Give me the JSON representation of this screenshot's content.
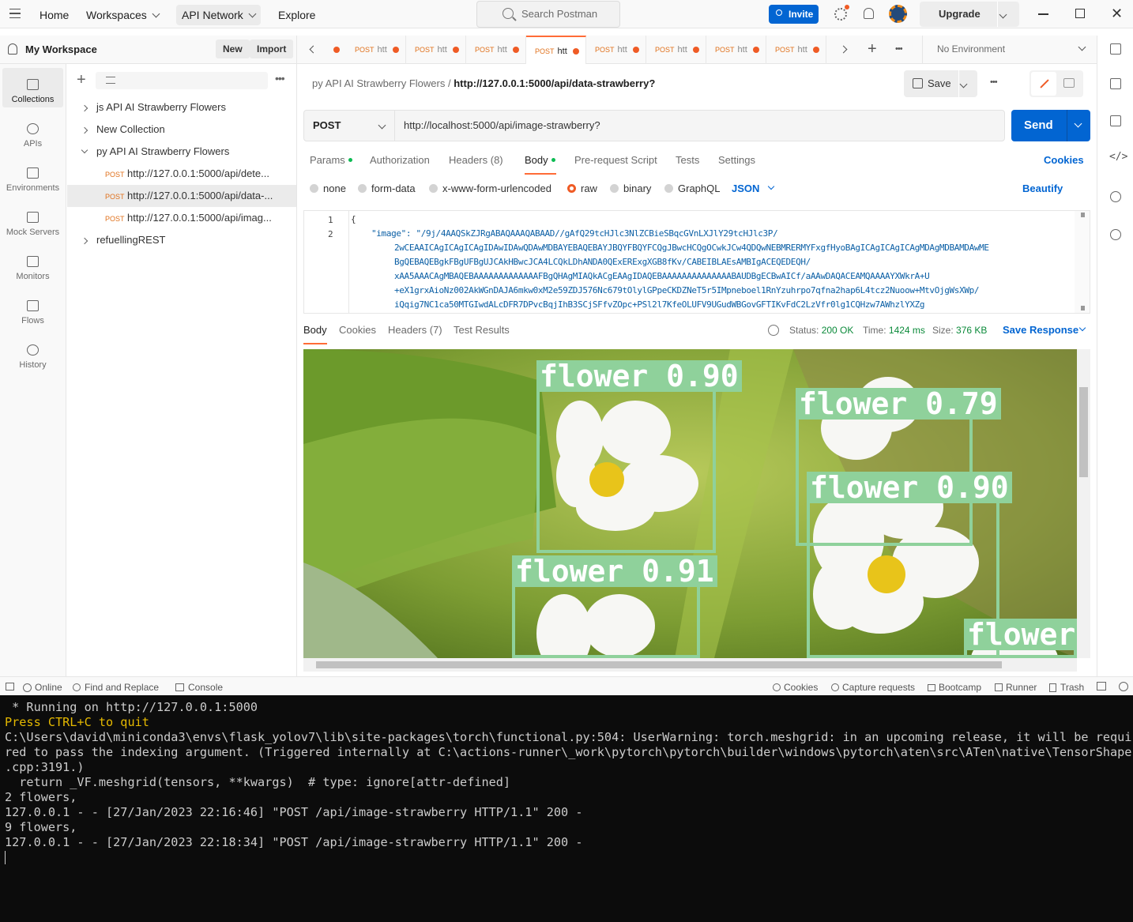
{
  "topbar": {
    "home": "Home",
    "workspaces": "Workspaces",
    "api_network": "API Network",
    "explore": "Explore",
    "search_placeholder": "Search Postman",
    "invite": "Invite",
    "upgrade": "Upgrade"
  },
  "workspace": {
    "name": "My Workspace",
    "new_label": "New",
    "import_label": "Import"
  },
  "rail": [
    {
      "label": "Collections",
      "icon": "collections-icon"
    },
    {
      "label": "APIs",
      "icon": "apis-icon"
    },
    {
      "label": "Environments",
      "icon": "environments-icon"
    },
    {
      "label": "Mock Servers",
      "icon": "mock-servers-icon"
    },
    {
      "label": "Monitors",
      "icon": "monitors-icon"
    },
    {
      "label": "Flows",
      "icon": "flows-icon"
    },
    {
      "label": "History",
      "icon": "history-icon"
    }
  ],
  "collections": [
    {
      "label": "js API AI Strawberry Flowers"
    },
    {
      "label": "New Collection"
    },
    {
      "label": "py API AI Strawberry Flowers"
    },
    {
      "method": "POST",
      "label": "http://127.0.0.1:5000/api/dete..."
    },
    {
      "method": "POST",
      "label": "http://127.0.0.1:5000/api/data-..."
    },
    {
      "method": "POST",
      "label": "http://127.0.0.1:5000/api/imag..."
    },
    {
      "label": "refuellingREST"
    }
  ],
  "tabs": [
    {
      "method": "POST",
      "label": "htt"
    },
    {
      "method": "POST",
      "label": "htt"
    },
    {
      "method": "POST",
      "label": "htt"
    },
    {
      "method": "POST",
      "label": "htt"
    },
    {
      "method": "POST",
      "label": "htt"
    },
    {
      "method": "POST",
      "label": "htt"
    },
    {
      "method": "POST",
      "label": "htt"
    },
    {
      "method": "POST",
      "label": "htt"
    }
  ],
  "environment": "No Environment",
  "request": {
    "breadcrumb_parent": "py API AI Strawberry Flowers",
    "breadcrumb_sep": "/",
    "breadcrumb_title": "http://127.0.0.1:5000/api/data-strawberry?",
    "save_label": "Save",
    "method": "POST",
    "url": "http://localhost:5000/api/image-strawberry?",
    "send_label": "Send",
    "tabs": [
      "Params",
      "Authorization",
      "Headers (8)",
      "Body",
      "Pre-request Script",
      "Tests",
      "Settings"
    ],
    "cookies_label": "Cookies",
    "body_types": [
      "none",
      "form-data",
      "x-www-form-urlencoded",
      "raw",
      "binary",
      "GraphQL"
    ],
    "body_format": "JSON",
    "beautify_label": "Beautify",
    "code_lines": [
      "{",
      "\"image\": \"/9j/4AAQSkZJRgABAQAAAQABAAD//gAfQ29tcHJlc3NlZCBieSBqcGVnLXJlY29tcHJlc3P/",
      "2wCEAAICAgICAgICAgIDAwIDAwQDAwMDBAYEBAQEBAYJBQYFBQYFCQgJBwcHCQgOCwkJCw4QDQwNEBMRERMYFxgfHyoBAgICAgICAgICAgMDAgMDBAMDAwME",
      "BgQEBAQEBgkFBgUFBgUJCAkHBwcJCA4LCQkLDhANDA0QExERExgXGB8fKv/CABEIBLAEsAMBIgACEQEDEQH/",
      "xAA5AAACAgMBAQEBAAAAAAAAAAAAAFBgQHAgMIAQkACgEAAgIDAQEBAAAAAAAAAAAAAABAUDBgECBwAICf/aAAwDAQACEAMQAAAAYXWkrA+U",
      "+eX1grxAioNz002AkWGnDAJA6mkw0xM2e59ZDJ576Nc679tOlylGPpeCKDZNeT5r5IMpneboel1RnYzuhrpo7qfna2hap6L4tcz2Nuoow+MtvOjgWsXWp/",
      "iQqig7NC1ca50MTGIwdALcDFR7DPvcBqjIhB3SCjSFfvZOpc+PSl2l7KfeOLUFV9UGudWBGovGFTIKvFdC2LzVfr0lg1CQHzw7AWhzlYXZg"
    ]
  },
  "response": {
    "tabs": [
      "Body",
      "Cookies",
      "Headers (7)",
      "Test Results"
    ],
    "status_label": "Status:",
    "status_value": "200 OK",
    "time_label": "Time:",
    "time_value": "1424 ms",
    "size_label": "Size:",
    "size_value": "376 KB",
    "save_response": "Save Response",
    "detections": [
      {
        "label": "flower 0.90"
      },
      {
        "label": "flower 0.79"
      },
      {
        "label": "flower 0.90"
      },
      {
        "label": "flower 0.91"
      },
      {
        "label": "flower"
      }
    ]
  },
  "footer": {
    "online": "Online",
    "find_replace": "Find and Replace",
    "console": "Console",
    "cookies": "Cookies",
    "capture": "Capture requests",
    "bootcamp": "Bootcamp",
    "runner": "Runner",
    "trash": "Trash"
  },
  "terminal": [
    " * Running on http://127.0.0.1:5000",
    "Press CTRL+C to quit",
    "C:\\Users\\david\\miniconda3\\envs\\flask_yolov7\\lib\\site-packages\\torch\\functional.py:504: UserWarning: torch.meshgrid: in an upcoming release, it will be requi",
    "red to pass the indexing argument. (Triggered internally at C:\\actions-runner\\_work\\pytorch\\pytorch\\builder\\windows\\pytorch\\aten\\src\\ATen\\native\\TensorShape",
    ".cpp:3191.)",
    "  return _VF.meshgrid(tensors, **kwargs)  # type: ignore[attr-defined]",
    "2 flowers,",
    "127.0.0.1 - - [27/Jan/2023 22:16:46] \"POST /api/image-strawberry HTTP/1.1\" 200 -",
    "9 flowers,",
    "127.0.0.1 - - [27/Jan/2023 22:18:34] \"POST /api/image-strawberry HTTP/1.1\" 200 -"
  ]
}
